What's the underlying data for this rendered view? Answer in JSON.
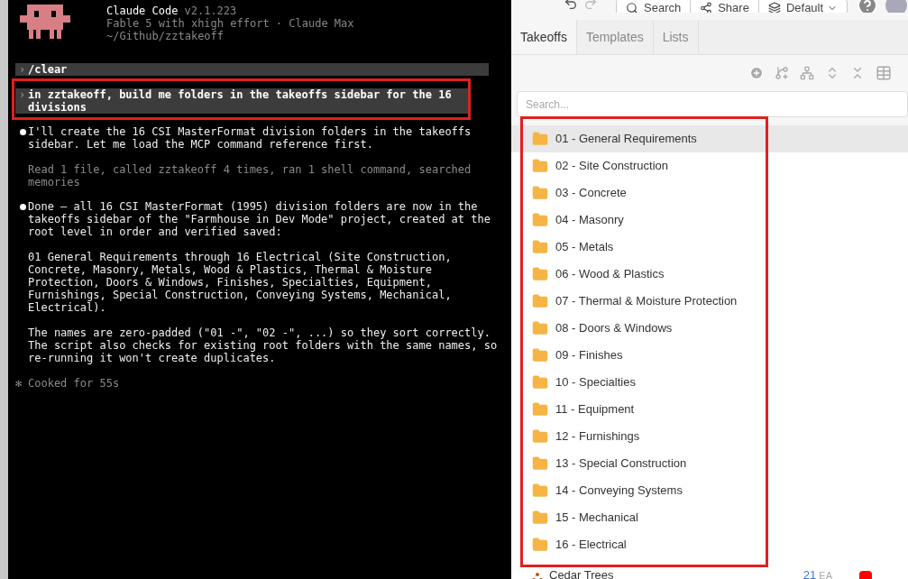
{
  "terminal": {
    "app_name": "Claude Code",
    "version": "v2.1.223",
    "model_line": "Fable 5 with xhigh effort · Claude Max",
    "path": "~/Github/zztakeoff",
    "messages": [
      {
        "kind": "prompt",
        "marker": "›",
        "text": "/clear",
        "highlighted": false
      },
      {
        "kind": "prompt",
        "marker": "›",
        "text": "in zztakeoff, build me folders in the takeoffs sidebar for the 16 divisions",
        "highlighted": true
      },
      {
        "kind": "response",
        "text": "I'll create the 16 CSI MasterFormat division folders in the takeoffs sidebar. Let me load the MCP command reference first."
      },
      {
        "kind": "detail",
        "text": "Read 1 file, called zztakeoff 4 times, ran 1 shell command, searched memories"
      },
      {
        "kind": "response",
        "text": "Done — all 16 CSI MasterFormat (1995) division folders are now in the takeoffs sidebar of the \"Farmhouse in Dev Mode\" project, created at the root level in order and verified saved:"
      },
      {
        "kind": "paragraph",
        "text": "01 General Requirements through 16 Electrical (Site Construction, Concrete, Masonry, Metals, Wood & Plastics, Thermal & Moisture Protection, Doors & Windows, Finishes, Specialties, Equipment, Furnishings, Special Construction, Conveying Systems, Mechanical, Electrical)."
      },
      {
        "kind": "paragraph",
        "text": "The names are zero-padded (\"01 -\", \"02 -\", ...) so they sort correctly. The script also checks for existing root folders with the same names, so re-running it won't create duplicates."
      },
      {
        "kind": "status",
        "symbol": "✻",
        "text": "Cooked for 55s"
      }
    ]
  },
  "sidebar": {
    "top_buttons": [
      "Search",
      "Share",
      "Default"
    ],
    "tabs": [
      {
        "label": "Takeoffs",
        "selected": true
      },
      {
        "label": "Templates",
        "selected": false
      },
      {
        "label": "Lists",
        "selected": false
      }
    ],
    "search": {
      "placeholder": "Search..."
    },
    "items": [
      {
        "kind": "folder",
        "name": "01 - General Requirements",
        "selected": true,
        "highlighted": true
      },
      {
        "kind": "folder",
        "name": "02 - Site Construction",
        "selected": false,
        "highlighted": true
      },
      {
        "kind": "folder",
        "name": "03 - Concrete",
        "selected": false,
        "highlighted": true
      },
      {
        "kind": "folder",
        "name": "04 - Masonry",
        "selected": false,
        "highlighted": true
      },
      {
        "kind": "folder",
        "name": "05 - Metals",
        "selected": false,
        "highlighted": true
      },
      {
        "kind": "folder",
        "name": "06 - Wood & Plastics",
        "selected": false,
        "highlighted": true
      },
      {
        "kind": "folder",
        "name": "07 - Thermal & Moisture Protection",
        "selected": false,
        "highlighted": true
      },
      {
        "kind": "folder",
        "name": "08 - Doors & Windows",
        "selected": false,
        "highlighted": true
      },
      {
        "kind": "folder",
        "name": "09 - Finishes",
        "selected": false,
        "highlighted": true
      },
      {
        "kind": "folder",
        "name": "10 - Specialties",
        "selected": false,
        "highlighted": true
      },
      {
        "kind": "folder",
        "name": "11 - Equipment",
        "selected": false,
        "highlighted": true
      },
      {
        "kind": "folder",
        "name": "12 - Furnishings",
        "selected": false,
        "highlighted": true
      },
      {
        "kind": "folder",
        "name": "13 - Special Construction",
        "selected": false,
        "highlighted": true
      },
      {
        "kind": "folder",
        "name": "14 - Conveying Systems",
        "selected": false,
        "highlighted": true
      },
      {
        "kind": "folder",
        "name": "15 - Mechanical",
        "selected": false,
        "highlighted": true
      },
      {
        "kind": "folder",
        "name": "16 - Electrical",
        "selected": false,
        "highlighted": true
      },
      {
        "kind": "takeoff",
        "name": "Cedar Trees",
        "quantity": "21",
        "unit": "EA",
        "color": "#ff0000",
        "selected": false,
        "highlighted": false
      }
    ]
  }
}
